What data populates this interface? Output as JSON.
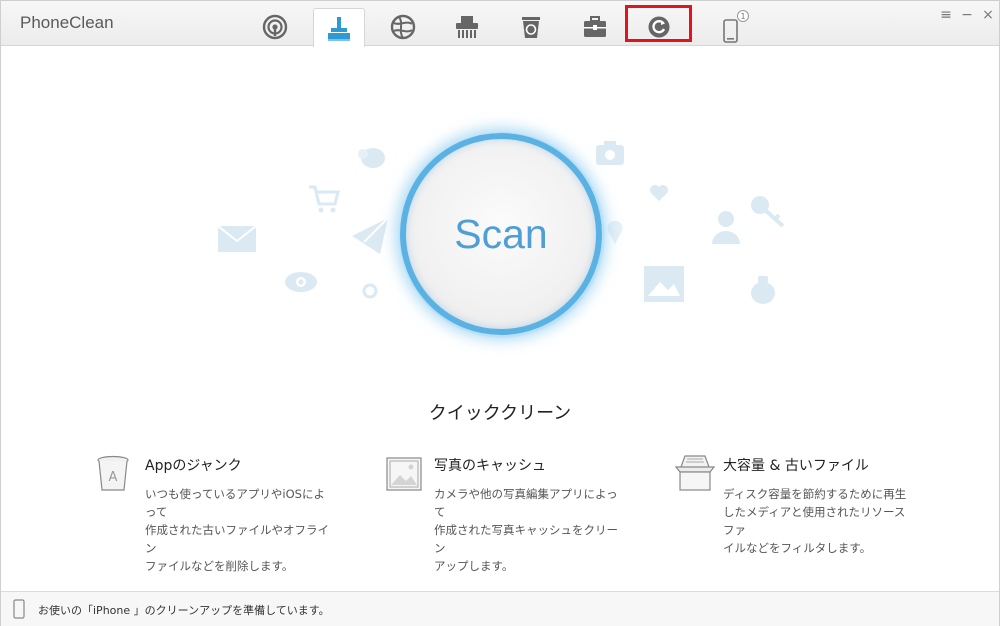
{
  "app": {
    "title": "PhoneClean"
  },
  "tabs": [
    {
      "name": "tab-wireless",
      "icon": "wireless-icon"
    },
    {
      "name": "tab-quick-clean",
      "icon": "broom-icon",
      "active": true
    },
    {
      "name": "tab-internet",
      "icon": "globe-icon"
    },
    {
      "name": "tab-shredder",
      "icon": "shredder-icon"
    },
    {
      "name": "tab-recycle",
      "icon": "recycle-bin-icon"
    },
    {
      "name": "tab-toolbox",
      "icon": "toolbox-icon"
    },
    {
      "name": "tab-backup-restore",
      "icon": "restore-icon",
      "highlighted": true
    },
    {
      "name": "tab-device",
      "icon": "phone-icon",
      "badge": "1"
    }
  ],
  "window_controls": {
    "menu": "≡",
    "minimize": "−",
    "close": "×"
  },
  "scan": {
    "label": "Scan"
  },
  "main": {
    "section_title": "クイッククリーン"
  },
  "features": [
    {
      "title": "Appのジャンク",
      "desc_lines": [
        "いつも使っているアプリやiOSによって",
        "作成された古いファイルやオフライン",
        "ファイルなどを削除します。"
      ],
      "icon": "trash-can-icon"
    },
    {
      "title": "写真のキャッシュ",
      "desc_lines": [
        "カメラや他の写真編集アプリによって",
        "作成された写真キャッシュをクリーン",
        "アップします。"
      ],
      "icon": "photo-icon"
    },
    {
      "title": "大容量 & 古いファイル",
      "desc_lines": [
        "ディスク容量を節約するために再生",
        "したメディアと使用されたリソースファ",
        "イルなどをフィルタします。"
      ],
      "icon": "file-box-icon"
    }
  ],
  "status": {
    "text": "お使いの「iPhone 」のクリーンアップを準備しています。"
  },
  "colors": {
    "accent": "#5ab1e3",
    "highlight": "#e0141e",
    "icon_gray": "#666666",
    "bg_icon": "#dbe9f3"
  }
}
